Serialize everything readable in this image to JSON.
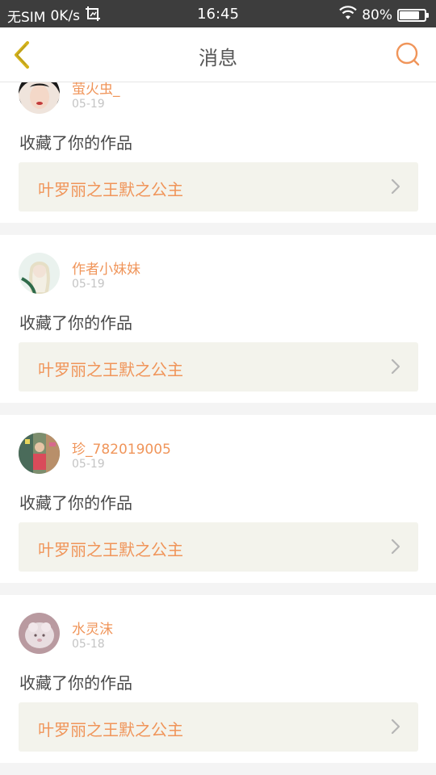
{
  "status_bar": {
    "carrier": "无SIM",
    "speed": "0K/s",
    "time": "16:45",
    "battery": "80%",
    "battery_level": 0.8,
    "screenshot_icon": "screenshot-icon",
    "wifi_icon": "wifi-icon"
  },
  "nav": {
    "title": "消息",
    "back_icon": "chevron-left-icon",
    "search_icon": "search-icon"
  },
  "colors": {
    "accent": "#f0955a",
    "back_arrow": "#d4b21a",
    "text": "#4a4a4a",
    "muted": "#c4c4c4",
    "work_bg": "#f3f3ec"
  },
  "messages": [
    {
      "user": "萤火虫_",
      "date": "05-19",
      "action": "收藏了你的作品",
      "work": "叶罗丽之王默之公主"
    },
    {
      "user": "作者小妹妹",
      "date": "05-19",
      "action": "收藏了你的作品",
      "work": "叶罗丽之王默之公主"
    },
    {
      "user": "珍_782019005",
      "date": "05-19",
      "action": "收藏了你的作品",
      "work": "叶罗丽之王默之公主"
    },
    {
      "user": "水灵沫",
      "date": "05-18",
      "action": "收藏了你的作品",
      "work": "叶罗丽之王默之公主"
    }
  ]
}
